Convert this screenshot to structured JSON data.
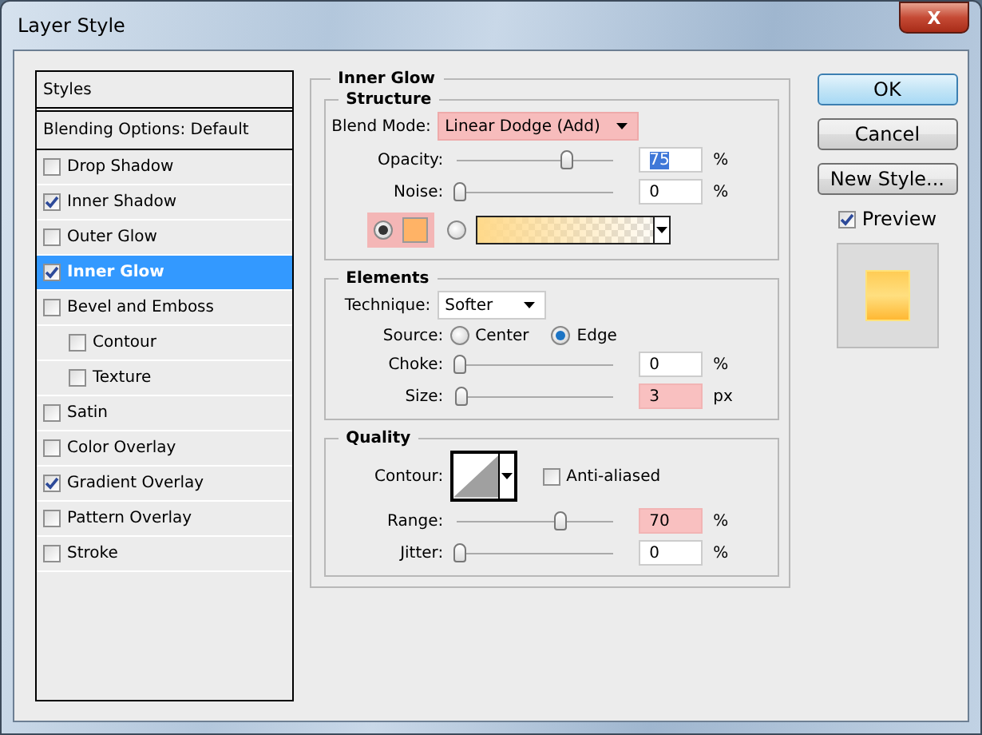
{
  "window": {
    "title": "Layer Style",
    "close": "X"
  },
  "sidebar": {
    "items": [
      {
        "kind": "header",
        "label": "Styles"
      },
      {
        "kind": "header",
        "label": "Blending Options: Default"
      },
      {
        "kind": "effect",
        "label": "Drop Shadow",
        "checked": false,
        "selected": false
      },
      {
        "kind": "effect",
        "label": "Inner Shadow",
        "checked": true,
        "selected": false
      },
      {
        "kind": "effect",
        "label": "Outer Glow",
        "checked": false,
        "selected": false
      },
      {
        "kind": "effect",
        "label": "Inner Glow",
        "checked": true,
        "selected": true
      },
      {
        "kind": "effect",
        "label": "Bevel and Emboss",
        "checked": false,
        "selected": false,
        "children": [
          {
            "kind": "effect",
            "label": "Contour",
            "checked": false,
            "selected": false
          },
          {
            "kind": "effect",
            "label": "Texture",
            "checked": false,
            "selected": false
          }
        ]
      },
      {
        "kind": "effect",
        "label": "Satin",
        "checked": false,
        "selected": false
      },
      {
        "kind": "effect",
        "label": "Color Overlay",
        "checked": false,
        "selected": false
      },
      {
        "kind": "effect",
        "label": "Gradient Overlay",
        "checked": true,
        "selected": false
      },
      {
        "kind": "effect",
        "label": "Pattern Overlay",
        "checked": false,
        "selected": false
      },
      {
        "kind": "effect",
        "label": "Stroke",
        "checked": false,
        "selected": false
      }
    ]
  },
  "panel": {
    "title": "Inner Glow",
    "structure": {
      "title": "Structure",
      "blend_mode": {
        "label": "Blend Mode:",
        "value": "Linear Dodge (Add)",
        "highlighted": true
      },
      "sliders": [
        {
          "label": "Opacity:",
          "level": 0.75,
          "value": "75",
          "unit": "%",
          "highlighted": false,
          "value_selected": true
        },
        {
          "label": "Noise:",
          "level": 0,
          "value": "0",
          "unit": "%",
          "highlighted": false,
          "value_selected": false
        }
      ],
      "fill_options": [
        {
          "kind": "color",
          "selected": true,
          "color": "#ffb366",
          "highlighted": true
        },
        {
          "kind": "gradient",
          "selected": false,
          "highlighted": false
        }
      ]
    },
    "elements": {
      "title": "Elements",
      "technique": {
        "label": "Technique:",
        "value": "Softer"
      },
      "source": {
        "label": "Source:",
        "options": [
          {
            "label": "Center",
            "selected": false
          },
          {
            "label": "Edge",
            "selected": true
          }
        ]
      },
      "sliders": [
        {
          "label": "Choke:",
          "level": 0,
          "value": "0",
          "unit": "%",
          "highlighted": false,
          "value_selected": false
        },
        {
          "label": "Size:",
          "level": 0.02,
          "value": "3",
          "unit": "px",
          "highlighted": true,
          "value_selected": false
        }
      ]
    },
    "quality": {
      "title": "Quality",
      "contour": {
        "label": "Contour:"
      },
      "anti_aliased": {
        "label": "Anti-aliased",
        "checked": false
      },
      "sliders": [
        {
          "label": "Range:",
          "level": 0.7,
          "value": "70",
          "unit": "%",
          "highlighted": true,
          "value_selected": false
        },
        {
          "label": "Jitter:",
          "level": 0,
          "value": "0",
          "unit": "%",
          "highlighted": false,
          "value_selected": false
        }
      ]
    }
  },
  "buttons": [
    {
      "label": "OK",
      "default": true
    },
    {
      "label": "Cancel",
      "default": false
    },
    {
      "label": "New Style...",
      "default": false
    }
  ],
  "preview": {
    "label": "Preview",
    "checked": true
  }
}
